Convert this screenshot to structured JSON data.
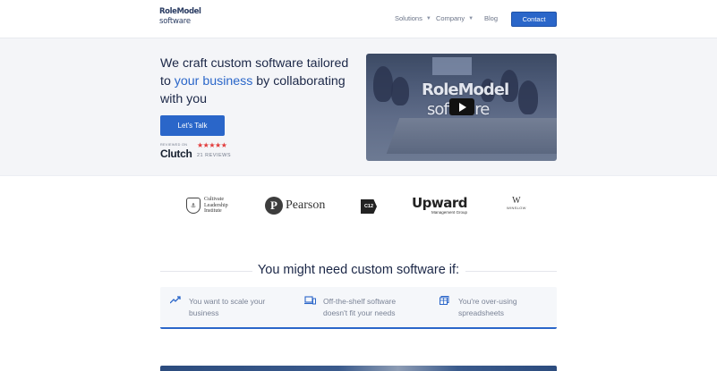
{
  "brand": {
    "logo_line1": "RoleModel",
    "logo_line2": "software"
  },
  "nav": {
    "solutions": "Solutions",
    "company": "Company",
    "blog": "Blog",
    "contact": "Contact"
  },
  "hero": {
    "title_part1": "We craft custom software tailored to ",
    "title_highlight": "your business",
    "title_part2": " by collaborating with you",
    "cta": "Let's Talk",
    "reviewed_on": "REVIEWED ON",
    "clutch": "Clutch",
    "stars": "★★★★★",
    "rating_stars": 5,
    "reviews": "21 REVIEWS",
    "video_logo_line1": "RoleModel",
    "video_logo_line2": "software"
  },
  "clients": {
    "cultivate": "Cultivate Leadership Institute",
    "pearson_mark": "P",
    "pearson": "Pearson",
    "c12": "C12",
    "upward": "Upward",
    "upward_sub": "Management Group",
    "winslow_mark": "W",
    "winslow": "WINSLOW"
  },
  "need": {
    "title": "You might need custom software if:",
    "items": [
      {
        "icon": "trending-up-icon",
        "text1": "You want to scale your",
        "text2": "business"
      },
      {
        "icon": "devices-icon",
        "text1": "Off-the-shelf software",
        "text2": "doesn't fit your needs"
      },
      {
        "icon": "spreadsheet-icon",
        "text1": "You're over-using",
        "text2": "spreadsheets"
      }
    ]
  },
  "colors": {
    "accent": "#2a66c9",
    "heading": "#1b2747",
    "stars": "#e23c3c"
  }
}
